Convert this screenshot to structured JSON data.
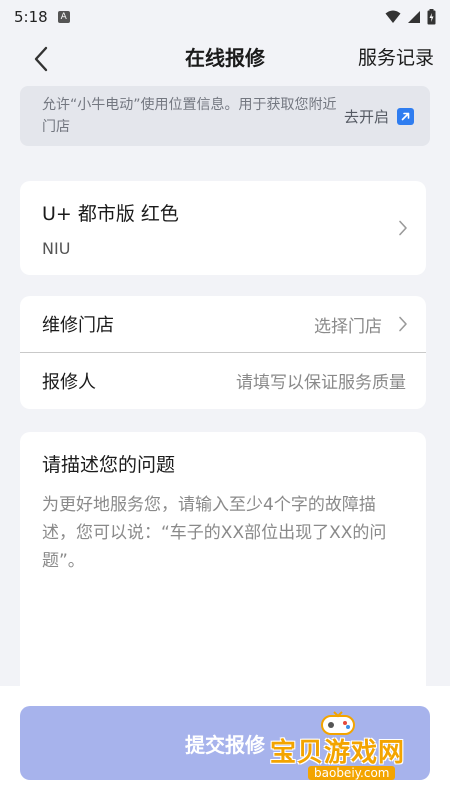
{
  "status": {
    "time": "5:18",
    "notif_badge": "A"
  },
  "header": {
    "title": "在线报修",
    "right_link": "服务记录"
  },
  "permission": {
    "text": "允许“小牛电动”使用位置信息。用于获取您附近门店",
    "action": "去开启",
    "action_icon": "external-link-icon",
    "accent": "#2f7df0"
  },
  "vehicle": {
    "name": "U+ 都市版 红色",
    "brand": "NIU"
  },
  "form": {
    "store_label": "维修门店",
    "store_value": "选择门店",
    "reporter_label": "报修人",
    "reporter_placeholder": "请填写以保证服务质量"
  },
  "description": {
    "title": "请描述您的问题",
    "placeholder": "为更好地服务您，请输入至少4个字的故障描述，您可以说：“车子的XX部位出现了XX的问题”。"
  },
  "submit": {
    "label": "提交报修",
    "color": "#a7b3ec"
  },
  "watermark": {
    "text": "宝贝游戏网",
    "url": "baobeiy.com"
  }
}
